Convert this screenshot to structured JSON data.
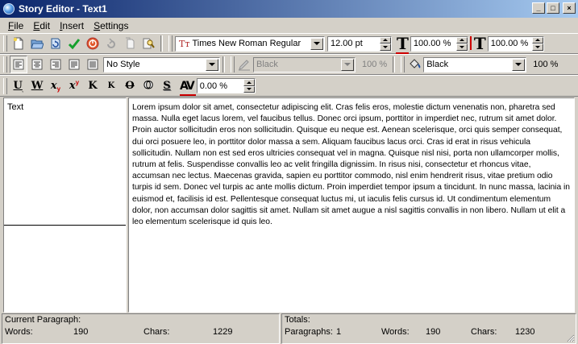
{
  "window": {
    "title": "Story Editor - Text1"
  },
  "window_buttons": {
    "minimize": "_",
    "maximize": "□",
    "close": "×"
  },
  "menu": [
    {
      "label": "File",
      "underline": "F",
      "rest": "ile"
    },
    {
      "label": "Edit",
      "underline": "E",
      "rest": "dit"
    },
    {
      "label": "Insert",
      "underline": "I",
      "rest": "nsert"
    },
    {
      "label": "Settings",
      "underline": "S",
      "rest": "ettings"
    }
  ],
  "toolbar1": {
    "icons": [
      "new-document-icon",
      "open-folder-icon",
      "reload-icon",
      "update-checkmark-icon",
      "exit-icon",
      "undo-icon",
      "copy-icon",
      "replace-icon"
    ],
    "font_name": "Times New Roman Regular",
    "font_size": "12.00 pt",
    "width_scale": "100.00 %",
    "height_scale": "100.00 %"
  },
  "toolbar2": {
    "align_icons": [
      "align-left-icon",
      "align-center-icon",
      "align-right-icon",
      "align-justify-icon",
      "align-forced-icon"
    ],
    "paragraph_style": "No Style",
    "stroke_color": "Black",
    "stroke_shade": "100 %",
    "fill_color": "Black",
    "fill_shade": "100 %"
  },
  "toolbar3": {
    "style_buttons": [
      {
        "name": "underline-button",
        "glyph": "U"
      },
      {
        "name": "word-underline-button",
        "glyph": "W"
      },
      {
        "name": "subscript-button",
        "glyph": "x"
      },
      {
        "name": "superscript-button",
        "glyph": "x"
      },
      {
        "name": "all-caps-button",
        "glyph": "K"
      },
      {
        "name": "small-caps-button",
        "glyph": "K"
      },
      {
        "name": "strikethrough-button",
        "glyph": "O"
      },
      {
        "name": "outline-button",
        "glyph": "O"
      },
      {
        "name": "shadow-button",
        "glyph": "S"
      }
    ],
    "tracking": "0.00 %"
  },
  "left_panel": {
    "paragraph_style_label": "Text"
  },
  "body_text": "Lorem ipsum dolor sit amet, consectetur adipiscing elit. Cras felis eros, molestie dictum venenatis non, pharetra sed massa. Nulla eget lacus lorem, vel faucibus tellus. Donec orci ipsum, porttitor in imperdiet nec, rutrum sit amet dolor. Proin auctor sollicitudin eros non sollicitudin. Quisque eu neque est. Aenean scelerisque, orci quis semper consequat, dui orci posuere leo, in porttitor dolor massa a sem. Aliquam faucibus lacus orci. Cras id erat in risus vehicula sollicitudin. Nullam non est sed eros ultricies consequat vel in magna. Quisque nisl nisi, porta non ullamcorper mollis, rutrum at felis. Suspendisse convallis leo ac velit fringilla dignissim. In risus nisi, consectetur et rhoncus vitae, accumsan nec lectus. Maecenas gravida, sapien eu porttitor commodo, nisl enim hendrerit risus, vitae pretium odio turpis id sem. Donec vel turpis ac ante mollis dictum. Proin imperdiet tempor ipsum a tincidunt. In nunc massa, lacinia in euismod et, facilisis id est. Pellentesque consequat luctus mi, ut iaculis felis cursus id. Ut condimentum elementum dolor, non accumsan dolor sagittis sit amet. Nullam sit amet augue a nisl sagittis convallis in non libero. Nullam ut elit a leo elementum scelerisque id quis leo.",
  "status": {
    "current_paragraph_label": "Current Paragraph:",
    "words_label": "Words:",
    "words": "190",
    "chars_label": "Chars:",
    "chars": "1229",
    "totals_label": "Totals:",
    "paragraphs_label": "Paragraphs:",
    "paragraphs": "1",
    "total_words_label": "Words:",
    "total_words": "190",
    "total_chars_label": "Chars:",
    "total_chars": "1230"
  }
}
